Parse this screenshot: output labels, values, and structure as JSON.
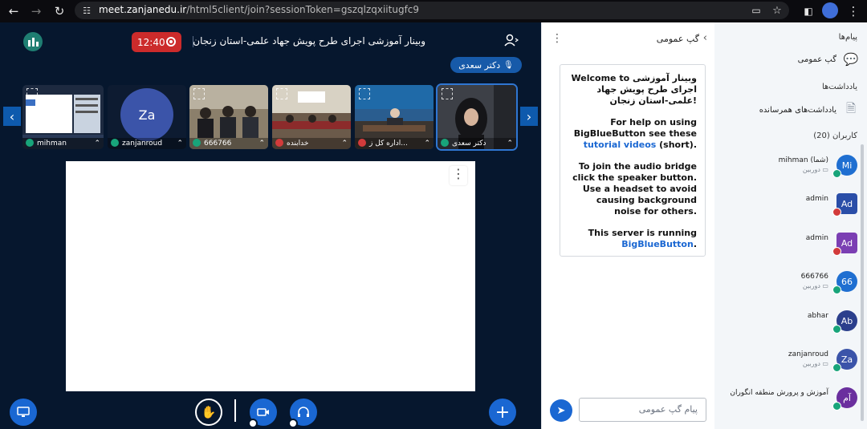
{
  "browser": {
    "url_host": "meet.zanjanedu.ir",
    "url_path": "/html5client/join?sessionToken=gszqlzqxiitugfc9"
  },
  "meeting": {
    "title": "وبینار آموزشی اجرای طرح پویش جهاد علمی-استان زنجان",
    "record_time": "12:40",
    "presenter": "دکتر سعدی"
  },
  "tiles": [
    {
      "name": "mihman",
      "muted": false
    },
    {
      "name": "zanjanroud",
      "avatar": "Za",
      "muted": false
    },
    {
      "name": "666766",
      "muted": false
    },
    {
      "name": "خدابنده",
      "muted": true
    },
    {
      "name": "اداره کل ز...",
      "muted": true
    },
    {
      "name": "دکتر سعدی",
      "muted": false
    }
  ],
  "chat": {
    "header": "گپ عمومی",
    "welcome": {
      "line1": "Welcome to وبینار آموزشی اجرای طرح پویش جهاد علمی-استان زنجان!",
      "line2a": "For help on using BigBlueButton see these ",
      "line2_link": "tutorial videos",
      "line2b": " (short).",
      "line3": "To join the audio bridge click the speaker button. Use a headset to avoid causing background noise for others.",
      "line4a": "This server is running ",
      "line4_link": "BigBlueButton",
      "line4b": "."
    },
    "input_placeholder": "پیام گپ عمومی"
  },
  "users_panel": {
    "messages_title": "پیام‌ها",
    "public_chat": "گپ عمومی",
    "notes_title": "یادداشت‌ها",
    "shared_notes": "یادداشت‌های همرسانده",
    "users_title": "کاربران (20)",
    "users": [
      {
        "initials": "Mi",
        "name": "mihman (شما)",
        "status": "دوربین",
        "color": "#1f6fd1",
        "square": false,
        "muted": false
      },
      {
        "initials": "Ad",
        "name": "admin",
        "status": "",
        "color": "#2a4ea8",
        "square": true,
        "muted": true
      },
      {
        "initials": "Ad",
        "name": "admin",
        "status": "",
        "color": "#7b3fb3",
        "square": true,
        "muted": true
      },
      {
        "initials": "66",
        "name": "666766",
        "status": "دوربین",
        "color": "#1f6fd1",
        "square": false,
        "muted": false
      },
      {
        "initials": "Ab",
        "name": "abhar",
        "status": "",
        "color": "#2b3f8c",
        "square": false,
        "muted": false
      },
      {
        "initials": "Za",
        "name": "zanjanroud",
        "status": "دوربین",
        "color": "#3b54a9",
        "square": false,
        "muted": false
      },
      {
        "initials": "آم",
        "name": "آموزش و پرورش منطقه انگوران",
        "status": "",
        "color": "#6a2f9e",
        "square": false,
        "muted": false
      }
    ]
  },
  "colors": {
    "background": "#06172e",
    "accent": "#1a67d2",
    "record": "#cc2b2b"
  }
}
